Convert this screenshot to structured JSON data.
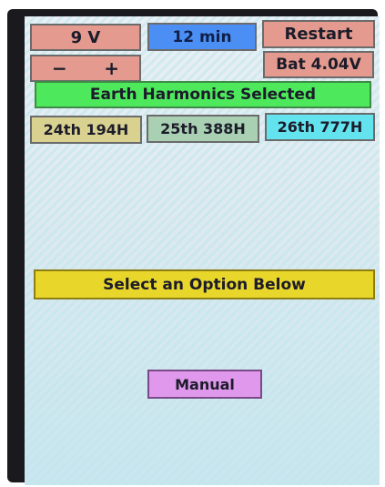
{
  "top_bar": {
    "voltage_label": "9 V",
    "timer_label": "12 min",
    "restart_label": "Restart",
    "minus_label": "−",
    "plus_label": "+",
    "battery_label": "Bat 4.04V"
  },
  "selection": {
    "label": "Earth Harmonics Selected"
  },
  "harmonics": [
    {
      "label": "24th 194H"
    },
    {
      "label": "25th 388H"
    },
    {
      "label": "26th 777H"
    }
  ],
  "prompt": {
    "label": "Select an Option Below"
  },
  "manual": {
    "label": "Manual"
  },
  "colors": {
    "salmon": "#e49a8e",
    "blue": "#4b8ff5",
    "green": "#4de85c",
    "tan": "#d9d190",
    "sage": "#a9d0b3",
    "cyan": "#62e3ee",
    "yellow": "#e8d62a",
    "violet": "#df98ec"
  }
}
